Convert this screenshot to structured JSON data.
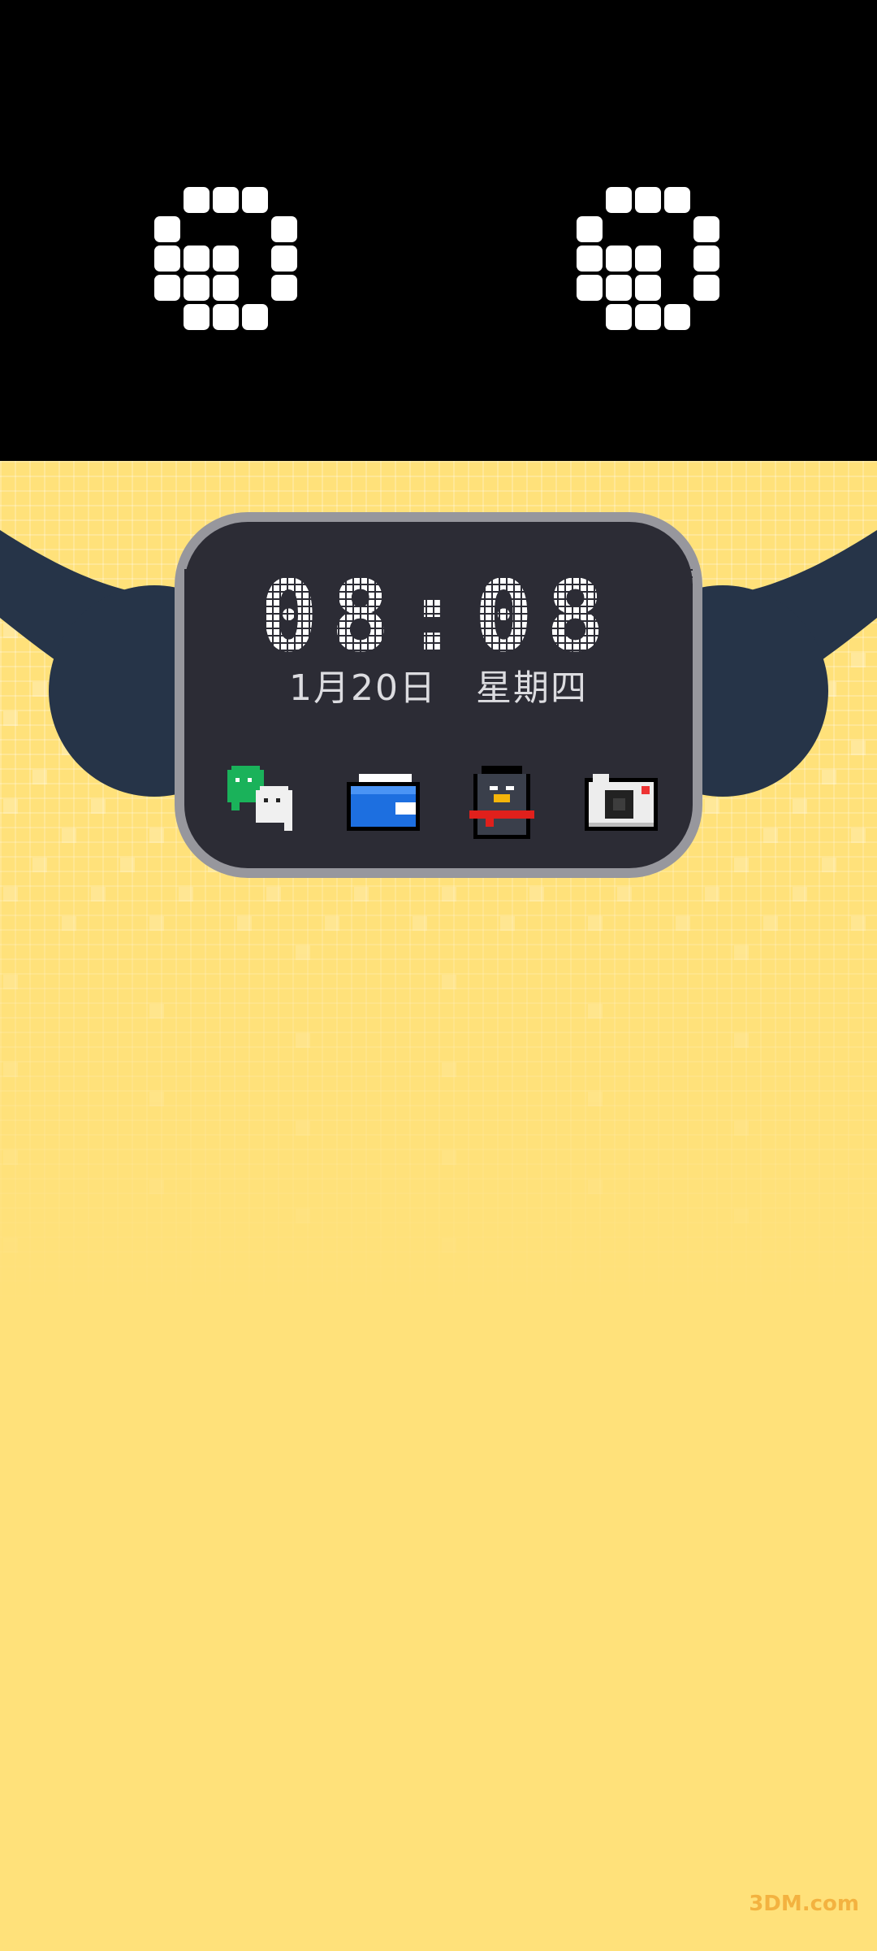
{
  "clock": {
    "time": "08:08"
  },
  "date": {
    "day": "1月20日",
    "weekday": "星期四"
  },
  "apps": [
    {
      "name": "wechat-icon"
    },
    {
      "name": "wallet-icon"
    },
    {
      "name": "qq-penguin-icon"
    },
    {
      "name": "camera-icon"
    }
  ],
  "colors": {
    "background": "#ffe17a",
    "top_band": "#000000",
    "widget_bg": "#2c2c35",
    "widget_border": "#97979d",
    "arms": "#263448"
  },
  "watermark": {
    "text": "3DM.com"
  }
}
